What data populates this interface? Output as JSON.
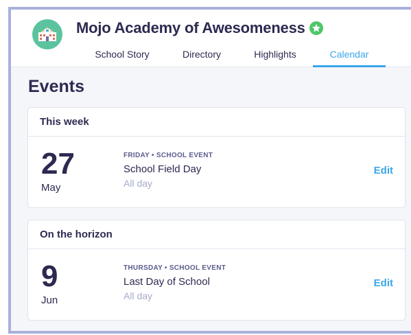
{
  "school": {
    "name": "Mojo Academy of Awesomeness",
    "logo_icon": "school-building-icon",
    "verified_icon": "verified-badge-icon"
  },
  "tabs": [
    {
      "label": "School Story",
      "active": false
    },
    {
      "label": "Directory",
      "active": false
    },
    {
      "label": "Highlights",
      "active": false
    },
    {
      "label": "Calendar",
      "active": true
    }
  ],
  "page": {
    "title": "Events"
  },
  "sections": [
    {
      "heading": "This week",
      "events": [
        {
          "day": "27",
          "month": "May",
          "meta": "FRIDAY • SCHOOL EVENT",
          "title": "School Field Day",
          "time": "All day",
          "edit_label": "Edit"
        }
      ]
    },
    {
      "heading": "On the horizon",
      "events": [
        {
          "day": "9",
          "month": "Jun",
          "meta": "THURSDAY • SCHOOL EVENT",
          "title": "Last Day of School",
          "time": "All day",
          "edit_label": "Edit"
        }
      ]
    }
  ],
  "colors": {
    "accent": "#3aa6e8",
    "text": "#2c2a50",
    "logo_bg": "#5bc49e",
    "verified": "#4fc768"
  }
}
